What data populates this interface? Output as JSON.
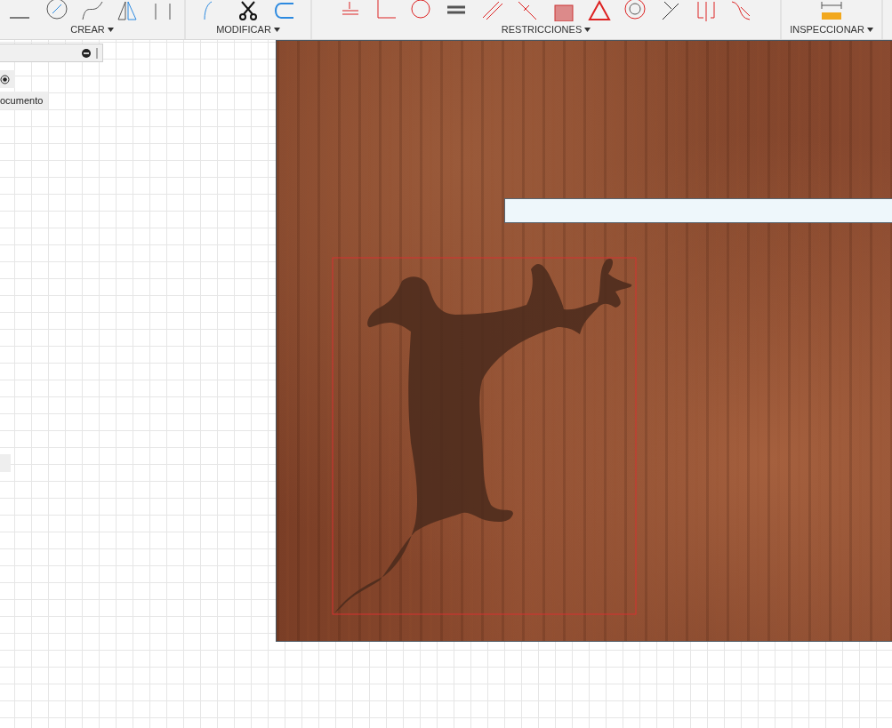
{
  "toolbar": {
    "groups": [
      {
        "label": "CREAR"
      },
      {
        "label": "MODIFICAR"
      },
      {
        "label": "RESTRICCIONES"
      },
      {
        "label": "INSPECCIONAR"
      }
    ]
  },
  "browser": {
    "document_label": "ocumento"
  }
}
